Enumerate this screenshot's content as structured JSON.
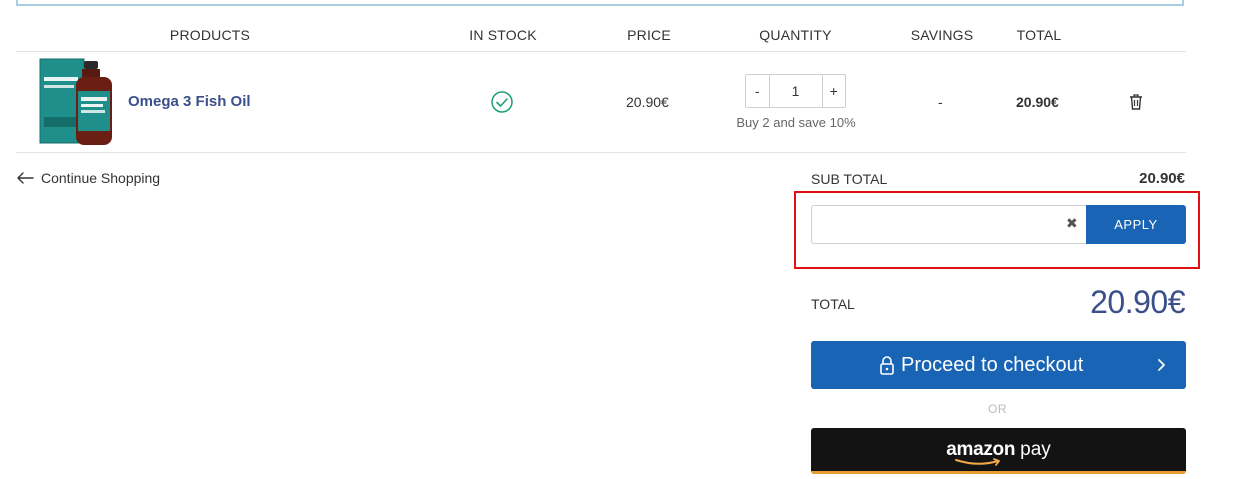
{
  "table": {
    "headers": {
      "products": "PRODUCTS",
      "in_stock": "IN STOCK",
      "price": "PRICE",
      "quantity": "QUANTITY",
      "savings": "SAVINGS",
      "total": "TOTAL"
    },
    "row": {
      "name": "Omega 3 Fish Oil",
      "stock_icon": "check-circle-icon",
      "price": "20.90€",
      "quantity": "1",
      "minus": "-",
      "plus": "+",
      "quantity_note": "Buy 2 and save 10%",
      "savings": "-",
      "total": "20.90€",
      "remove_icon": "trash-icon"
    }
  },
  "continue": {
    "label": "Continue Shopping",
    "icon": "arrow-left-icon"
  },
  "summary": {
    "subtotal_label": "SUB TOTAL",
    "subtotal_value": "20.90€",
    "coupon_value": "",
    "coupon_clear": "✖",
    "apply_label": "APPLY",
    "total_label": "TOTAL",
    "total_value": "20.90€",
    "checkout_label": "Proceed to checkout",
    "or_label": "OR",
    "amazon_brand": "amazon",
    "amazon_pay": "pay"
  },
  "colors": {
    "primary": "#1a64b5",
    "link": "#3b4f8a",
    "stock_ok": "#1b9e77",
    "highlight_box": "#e40f14"
  }
}
